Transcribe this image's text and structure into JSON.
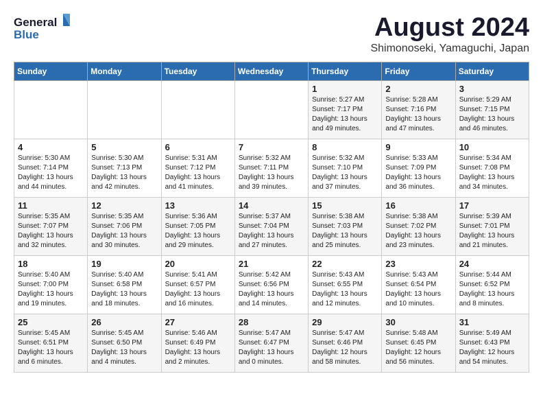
{
  "header": {
    "logo_general": "General",
    "logo_blue": "Blue",
    "month_title": "August 2024",
    "location": "Shimonoseki, Yamaguchi, Japan"
  },
  "weekdays": [
    "Sunday",
    "Monday",
    "Tuesday",
    "Wednesday",
    "Thursday",
    "Friday",
    "Saturday"
  ],
  "weeks": [
    [
      {
        "day": "",
        "info": ""
      },
      {
        "day": "",
        "info": ""
      },
      {
        "day": "",
        "info": ""
      },
      {
        "day": "",
        "info": ""
      },
      {
        "day": "1",
        "info": "Sunrise: 5:27 AM\nSunset: 7:17 PM\nDaylight: 13 hours\nand 49 minutes."
      },
      {
        "day": "2",
        "info": "Sunrise: 5:28 AM\nSunset: 7:16 PM\nDaylight: 13 hours\nand 47 minutes."
      },
      {
        "day": "3",
        "info": "Sunrise: 5:29 AM\nSunset: 7:15 PM\nDaylight: 13 hours\nand 46 minutes."
      }
    ],
    [
      {
        "day": "4",
        "info": "Sunrise: 5:30 AM\nSunset: 7:14 PM\nDaylight: 13 hours\nand 44 minutes."
      },
      {
        "day": "5",
        "info": "Sunrise: 5:30 AM\nSunset: 7:13 PM\nDaylight: 13 hours\nand 42 minutes."
      },
      {
        "day": "6",
        "info": "Sunrise: 5:31 AM\nSunset: 7:12 PM\nDaylight: 13 hours\nand 41 minutes."
      },
      {
        "day": "7",
        "info": "Sunrise: 5:32 AM\nSunset: 7:11 PM\nDaylight: 13 hours\nand 39 minutes."
      },
      {
        "day": "8",
        "info": "Sunrise: 5:32 AM\nSunset: 7:10 PM\nDaylight: 13 hours\nand 37 minutes."
      },
      {
        "day": "9",
        "info": "Sunrise: 5:33 AM\nSunset: 7:09 PM\nDaylight: 13 hours\nand 36 minutes."
      },
      {
        "day": "10",
        "info": "Sunrise: 5:34 AM\nSunset: 7:08 PM\nDaylight: 13 hours\nand 34 minutes."
      }
    ],
    [
      {
        "day": "11",
        "info": "Sunrise: 5:35 AM\nSunset: 7:07 PM\nDaylight: 13 hours\nand 32 minutes."
      },
      {
        "day": "12",
        "info": "Sunrise: 5:35 AM\nSunset: 7:06 PM\nDaylight: 13 hours\nand 30 minutes."
      },
      {
        "day": "13",
        "info": "Sunrise: 5:36 AM\nSunset: 7:05 PM\nDaylight: 13 hours\nand 29 minutes."
      },
      {
        "day": "14",
        "info": "Sunrise: 5:37 AM\nSunset: 7:04 PM\nDaylight: 13 hours\nand 27 minutes."
      },
      {
        "day": "15",
        "info": "Sunrise: 5:38 AM\nSunset: 7:03 PM\nDaylight: 13 hours\nand 25 minutes."
      },
      {
        "day": "16",
        "info": "Sunrise: 5:38 AM\nSunset: 7:02 PM\nDaylight: 13 hours\nand 23 minutes."
      },
      {
        "day": "17",
        "info": "Sunrise: 5:39 AM\nSunset: 7:01 PM\nDaylight: 13 hours\nand 21 minutes."
      }
    ],
    [
      {
        "day": "18",
        "info": "Sunrise: 5:40 AM\nSunset: 7:00 PM\nDaylight: 13 hours\nand 19 minutes."
      },
      {
        "day": "19",
        "info": "Sunrise: 5:40 AM\nSunset: 6:58 PM\nDaylight: 13 hours\nand 18 minutes."
      },
      {
        "day": "20",
        "info": "Sunrise: 5:41 AM\nSunset: 6:57 PM\nDaylight: 13 hours\nand 16 minutes."
      },
      {
        "day": "21",
        "info": "Sunrise: 5:42 AM\nSunset: 6:56 PM\nDaylight: 13 hours\nand 14 minutes."
      },
      {
        "day": "22",
        "info": "Sunrise: 5:43 AM\nSunset: 6:55 PM\nDaylight: 13 hours\nand 12 minutes."
      },
      {
        "day": "23",
        "info": "Sunrise: 5:43 AM\nSunset: 6:54 PM\nDaylight: 13 hours\nand 10 minutes."
      },
      {
        "day": "24",
        "info": "Sunrise: 5:44 AM\nSunset: 6:52 PM\nDaylight: 13 hours\nand 8 minutes."
      }
    ],
    [
      {
        "day": "25",
        "info": "Sunrise: 5:45 AM\nSunset: 6:51 PM\nDaylight: 13 hours\nand 6 minutes."
      },
      {
        "day": "26",
        "info": "Sunrise: 5:45 AM\nSunset: 6:50 PM\nDaylight: 13 hours\nand 4 minutes."
      },
      {
        "day": "27",
        "info": "Sunrise: 5:46 AM\nSunset: 6:49 PM\nDaylight: 13 hours\nand 2 minutes."
      },
      {
        "day": "28",
        "info": "Sunrise: 5:47 AM\nSunset: 6:47 PM\nDaylight: 13 hours\nand 0 minutes."
      },
      {
        "day": "29",
        "info": "Sunrise: 5:47 AM\nSunset: 6:46 PM\nDaylight: 12 hours\nand 58 minutes."
      },
      {
        "day": "30",
        "info": "Sunrise: 5:48 AM\nSunset: 6:45 PM\nDaylight: 12 hours\nand 56 minutes."
      },
      {
        "day": "31",
        "info": "Sunrise: 5:49 AM\nSunset: 6:43 PM\nDaylight: 12 hours\nand 54 minutes."
      }
    ]
  ]
}
